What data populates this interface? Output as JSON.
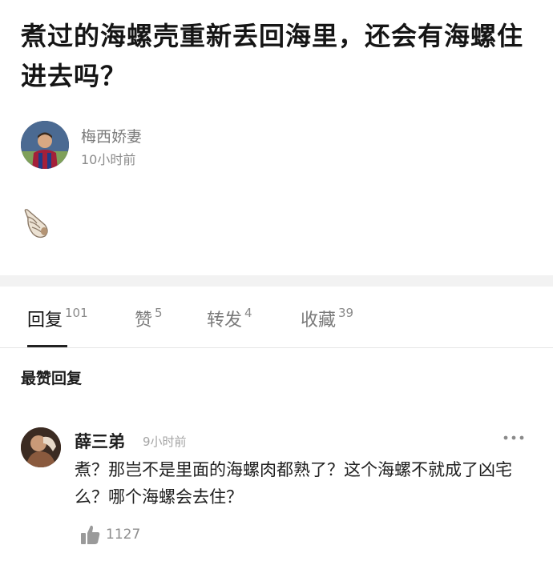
{
  "post": {
    "title": "煮过的海螺壳重新丢回海里，还会有海螺住进去吗？",
    "author": "梅西娇妻",
    "time": "10小时前",
    "emoji": "shell-emoji"
  },
  "tabs": [
    {
      "label": "回复",
      "count": "101",
      "active": true
    },
    {
      "label": "赞",
      "count": "5",
      "active": false
    },
    {
      "label": "转发",
      "count": "4",
      "active": false
    },
    {
      "label": "收藏",
      "count": "39",
      "active": false
    }
  ],
  "section_label": "最赞回复",
  "comment": {
    "user": "薛三弟",
    "time": "9小时前",
    "text": "煮？那岂不是里面的海螺肉都熟了？这个海螺不就成了凶宅么？哪个海螺会去住？",
    "likes": "1127"
  },
  "colors": {
    "divider": "#f2f2f2",
    "muted_text": "#7b7b7b",
    "active_tab": "#111111"
  }
}
